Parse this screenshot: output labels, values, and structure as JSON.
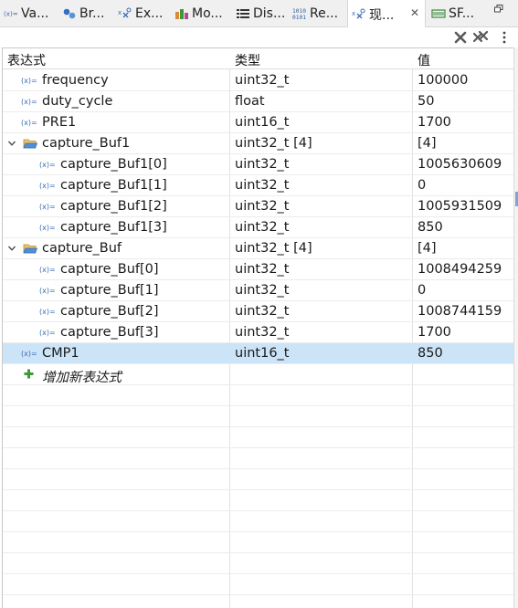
{
  "tabs": [
    {
      "label": "Va...",
      "icon": "variables-icon"
    },
    {
      "label": "Br...",
      "icon": "breakpoints-icon"
    },
    {
      "label": "Ex...",
      "icon": "expressions-icon"
    },
    {
      "label": "Mo...",
      "icon": "modules-icon"
    },
    {
      "label": "Dis...",
      "icon": "disassembly-icon"
    },
    {
      "label": "Re...",
      "icon": "registers-icon"
    },
    {
      "label": "现...",
      "icon": "live-expressions-icon"
    },
    {
      "label": "SF...",
      "icon": "sfr-icon"
    }
  ],
  "tab_icon_text": {
    "variables": "(x)=",
    "registers": "1010\n0101"
  },
  "columns": {
    "expression": "表达式",
    "type": "类型",
    "value": "值"
  },
  "rows": [
    {
      "name": "frequency",
      "type": "uint32_t",
      "value": "100000"
    },
    {
      "name": "duty_cycle",
      "type": "float",
      "value": "50"
    },
    {
      "name": "PRE1",
      "type": "uint16_t",
      "value": "1700"
    },
    {
      "name": "capture_Buf1",
      "type": "uint32_t [4]",
      "value": "[4]"
    },
    {
      "name": "capture_Buf1[0]",
      "type": "uint32_t",
      "value": "1005630609"
    },
    {
      "name": "capture_Buf1[1]",
      "type": "uint32_t",
      "value": "0"
    },
    {
      "name": "capture_Buf1[2]",
      "type": "uint32_t",
      "value": "1005931509"
    },
    {
      "name": "capture_Buf1[3]",
      "type": "uint32_t",
      "value": "850"
    },
    {
      "name": "capture_Buf",
      "type": "uint32_t [4]",
      "value": "[4]"
    },
    {
      "name": "capture_Buf[0]",
      "type": "uint32_t",
      "value": "1008494259"
    },
    {
      "name": "capture_Buf[1]",
      "type": "uint32_t",
      "value": "0"
    },
    {
      "name": "capture_Buf[2]",
      "type": "uint32_t",
      "value": "1008744159"
    },
    {
      "name": "capture_Buf[3]",
      "type": "uint32_t",
      "value": "1700"
    },
    {
      "name": "CMP1",
      "type": "uint16_t",
      "value": "850"
    }
  ],
  "add_expression": "增加新表达式",
  "selected_row": "CMP1",
  "colors": {
    "selection": "#cce4f7",
    "add_icon": "#3a9a3a",
    "remove_icon": "#5a5a5a"
  }
}
